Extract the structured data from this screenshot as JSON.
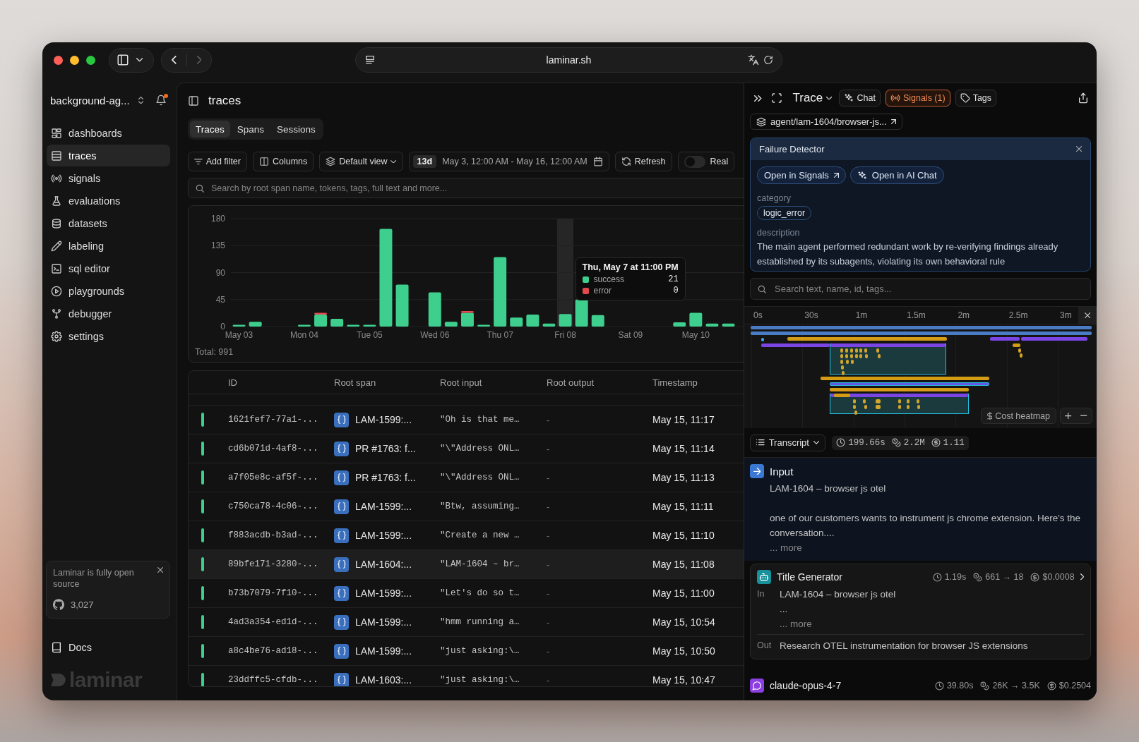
{
  "browser": {
    "url": "laminar.sh",
    "navigation": [
      {
        "kind": "back",
        "disabled": false
      },
      {
        "kind": "forward",
        "disabled": true
      }
    ]
  },
  "sidebar": {
    "workspace": "background-ag...",
    "notifications_unread": true,
    "items": [
      {
        "label": "dashboards",
        "selected": false
      },
      {
        "label": "traces",
        "selected": true
      },
      {
        "label": "signals",
        "selected": false
      },
      {
        "label": "evaluations",
        "selected": false
      },
      {
        "label": "datasets",
        "selected": false
      },
      {
        "label": "labeling",
        "selected": false
      },
      {
        "label": "sql editor",
        "selected": false
      },
      {
        "label": "playgrounds",
        "selected": false
      },
      {
        "label": "debugger",
        "selected": false
      },
      {
        "label": "settings",
        "selected": false
      }
    ],
    "promo": {
      "text": "Laminar is fully open source",
      "github_count": "3,027"
    },
    "docs": "Docs",
    "logo": "laminar"
  },
  "main": {
    "title": "traces",
    "tabs": [
      {
        "label": "Traces",
        "selected": true
      },
      {
        "label": "Spans",
        "selected": false
      },
      {
        "label": "Sessions",
        "selected": false
      }
    ],
    "toolbar": {
      "add_filter": "Add filter",
      "columns": "Columns",
      "view": "Default view",
      "range_badge": "13d",
      "range": "May 3, 12:00 AM - May 16, 12:00 AM",
      "refresh": "Refresh",
      "realtime": {
        "label": "Real",
        "on": false
      }
    },
    "search": {
      "placeholder": "Search by root span name, tokens, tags, full text and more..."
    },
    "chart": {
      "chart_data": {
        "type": "bar",
        "categories": [
          "May 03",
          null,
          null,
          null,
          "Mon 04",
          null,
          null,
          null,
          "Tue 05",
          null,
          null,
          null,
          "Wed 06",
          null,
          null,
          null,
          "Thu 07",
          null,
          null,
          null,
          "Fri 08",
          null,
          null,
          null,
          "Sat 09",
          null,
          null,
          null,
          "May 10",
          null,
          null
        ],
        "yticks": [
          0,
          45,
          90,
          135,
          180
        ],
        "ylim": [
          0,
          180
        ],
        "grid": true,
        "stacked": true,
        "legend": "bottom-right",
        "series": [
          {
            "name": "success",
            "color": "#3ecf8e",
            "values": [
              3,
              8,
              0,
              0,
              3,
              20,
              13,
              3,
              3,
              163,
              70,
              0,
              57,
              8,
              23,
              3,
              116,
              15,
              20,
              5,
              21,
              45,
              19,
              0,
              0,
              0,
              0,
              7,
              23,
              5,
              5
            ]
          },
          {
            "name": "error",
            "color": "#e5484d",
            "values": [
              0,
              0,
              0,
              0,
              0,
              3,
              0,
              0,
              0,
              0,
              0,
              0,
              0,
              0,
              3,
              0,
              0,
              0,
              0,
              0,
              0,
              0,
              0,
              0,
              0,
              0,
              0,
              0,
              0,
              0,
              0
            ]
          }
        ],
        "annotations": [
          "Thu, May 7 at 11:00 PM"
        ]
      },
      "tooltip": {
        "values": [
          "21",
          "0"
        ]
      },
      "total": "Total: 991"
    },
    "table": {
      "columns": [
        "ID",
        "Root span",
        "Root input",
        "Root output",
        "Timestamp"
      ],
      "rows": [
        {
          "color": "#3ecf8e",
          "id": "1621fef7-77a1-...",
          "root_span": "LAM-1599:...",
          "root_input": "\"Oh is that me…",
          "root_output": "-",
          "timestamp": "May 15, 11:17",
          "selected": false
        },
        {
          "color": "#3ecf8e",
          "id": "cd6b071d-4af8-...",
          "root_span": "PR #1763: f...",
          "root_input": "\"\\\"Address ONL…",
          "root_output": "-",
          "timestamp": "May 15, 11:14",
          "selected": false
        },
        {
          "color": "#3ecf8e",
          "id": "a7f05e8c-af5f-...",
          "root_span": "PR #1763: f...",
          "root_input": "\"\\\"Address ONL…",
          "root_output": "-",
          "timestamp": "May 15, 11:13",
          "selected": false
        },
        {
          "color": "#3ecf8e",
          "id": "c750ca78-4c06-...",
          "root_span": "LAM-1599:...",
          "root_input": "\"Btw, assuming…",
          "root_output": "-",
          "timestamp": "May 15, 11:11",
          "selected": false
        },
        {
          "color": "#3ecf8e",
          "id": "f883acdb-b3ad-...",
          "root_span": "LAM-1599:...",
          "root_input": "\"Create a new …",
          "root_output": "-",
          "timestamp": "May 15, 11:10",
          "selected": false
        },
        {
          "color": "#3ecf8e",
          "id": "89bfe171-3280-...",
          "root_span": "LAM-1604:...",
          "root_input": "\"LAM-1604 – br…",
          "root_output": "-",
          "timestamp": "May 15, 11:08",
          "selected": true
        },
        {
          "color": "#3ecf8e",
          "id": "b73b7079-7f10-...",
          "root_span": "LAM-1599:...",
          "root_input": "\"Let's do so t…",
          "root_output": "-",
          "timestamp": "May 15, 11:00",
          "selected": false
        },
        {
          "color": "#3ecf8e",
          "id": "4ad3a354-ed1d-...",
          "root_span": "LAM-1599:...",
          "root_input": "\"hmm running a…",
          "root_output": "-",
          "timestamp": "May 15, 10:54",
          "selected": false
        },
        {
          "color": "#3ecf8e",
          "id": "a8c4be76-ad18-...",
          "root_span": "LAM-1599:...",
          "root_input": "\"just asking:\\…",
          "root_output": "-",
          "timestamp": "May 15, 10:50",
          "selected": false
        },
        {
          "color": "#3ecf8e",
          "id": "23ddffc5-cfdb-...",
          "root_span": "LAM-1603:...",
          "root_input": "\"just asking:\\…",
          "root_output": "-",
          "timestamp": "May 15, 10:47",
          "selected": false
        }
      ]
    }
  },
  "trace_panel": {
    "title": "Trace",
    "buttons": [
      {
        "label": "Chat",
        "selected": false
      },
      {
        "label": "Signals (1)",
        "selected": true
      },
      {
        "label": "Tags",
        "selected": false
      }
    ],
    "path": "agent/lam-1604/browser-js...",
    "signal": {
      "title": "Failure Detector",
      "actions": [
        "Open in Signals",
        "Open in AI Chat"
      ],
      "fields": [
        {
          "label": "category",
          "kind": "chip",
          "value": "logic_error"
        },
        {
          "label": "description",
          "kind": "text",
          "value": "The main agent performed redundant work by re-verifying findings already established by its subagents, violating its own behavioral rule"
        }
      ]
    },
    "search": {
      "placeholder": "Search text, name, id, tags..."
    },
    "timeline": {
      "ticks": [
        "0s",
        "30s",
        "1m",
        "1.5m",
        "2m",
        "2.5m",
        "3m"
      ],
      "cost_heatmap": "Cost heatmap"
    },
    "view": "Transcript",
    "stats": [
      "199.66s",
      "2.2M",
      "1.11"
    ],
    "input": {
      "title": "Input",
      "paragraphs": [
        "LAM-1604 – browser js otel",
        "one of our customers wants to instrument js chrome extension. Here's the conversation...."
      ],
      "more": "... more"
    },
    "spans": [
      {
        "kind": "agent",
        "name": "Title Generator",
        "duration": "1.19s",
        "tokens": "661 → 18",
        "cost": "$0.0008",
        "input_label": "In",
        "input_lines": [
          "LAM-1604 – browser js otel",
          "..."
        ],
        "more": "... more",
        "output_label": "Out",
        "output": "Research OTEL instrumentation for browser JS extensions"
      },
      {
        "kind": "llm",
        "name": "claude-opus-4-7",
        "duration": "39.80s",
        "tokens": "26K → 3.5K",
        "cost": "$0.2504"
      }
    ]
  }
}
